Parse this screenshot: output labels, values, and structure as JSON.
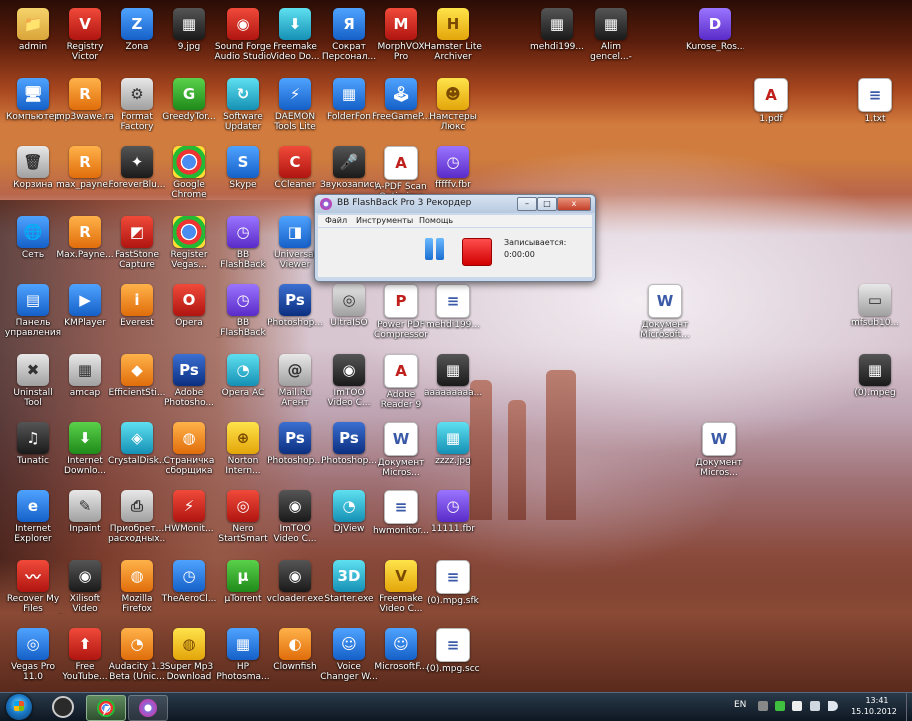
{
  "desktop": {
    "icons": [
      {
        "label": "admin",
        "icon": "user-folder-icon",
        "cls": "c-folder",
        "glyph": "📁"
      },
      {
        "label": "Registry Victor",
        "icon": "registry-victor-icon",
        "cls": "c-red",
        "glyph": "V"
      },
      {
        "label": "Zona",
        "icon": "zona-icon",
        "cls": "c-blue",
        "glyph": "Z"
      },
      {
        "label": "9.jpg",
        "icon": "image-file-icon",
        "cls": "c-dark",
        "glyph": "▦"
      },
      {
        "label": "Sound Forge Audio Studio",
        "icon": "sound-forge-icon",
        "cls": "c-red",
        "glyph": "◉"
      },
      {
        "label": "Freemake Video Do...",
        "icon": "freemake-video-downloader-icon",
        "cls": "c-cyan",
        "glyph": "⬇"
      },
      {
        "label": "Сократ Персонал...",
        "icon": "sokrat-icon",
        "cls": "c-blue",
        "glyph": "Я"
      },
      {
        "label": "MorphVOX Pro",
        "icon": "morphvox-icon",
        "cls": "c-red",
        "glyph": "M"
      },
      {
        "label": "Hamster Lite Archiver",
        "icon": "hamster-archiver-icon",
        "cls": "c-yellow",
        "glyph": "H"
      },
      {
        "label": "mehdi199...",
        "icon": "image-file-icon",
        "cls": "c-dark",
        "glyph": "▦"
      },
      {
        "label": "Alim gencel...-ta...",
        "icon": "image-file-icon",
        "cls": "c-dark",
        "glyph": "▦"
      },
      {
        "label": "Kurose_Ros...",
        "icon": "djvu-file-icon",
        "cls": "c-purple",
        "glyph": "D"
      },
      {
        "label": "Компьютер",
        "icon": "computer-icon",
        "cls": "c-blue",
        "glyph": "🖥"
      },
      {
        "label": "mp3wawe.rar",
        "icon": "rar-archive-icon",
        "cls": "c-orange",
        "glyph": "R"
      },
      {
        "label": "Format Factory",
        "icon": "format-factory-icon",
        "cls": "c-gray",
        "glyph": "⚙"
      },
      {
        "label": "GreedyTor...",
        "icon": "greedytorrent-icon",
        "cls": "c-green",
        "glyph": "G"
      },
      {
        "label": "Software Updater",
        "icon": "software-updater-icon",
        "cls": "c-cyan",
        "glyph": "↻"
      },
      {
        "label": "DAEMON Tools Lite",
        "icon": "daemon-tools-icon",
        "cls": "c-blue",
        "glyph": "⚡"
      },
      {
        "label": "FolderFon",
        "icon": "folderfon-icon",
        "cls": "c-blue",
        "glyph": "▦"
      },
      {
        "label": "FreeGameP...",
        "icon": "freegame-icon",
        "cls": "c-blue",
        "glyph": "🕹"
      },
      {
        "label": "Намстеры Люкс",
        "icon": "hamster-icon",
        "cls": "c-yellow",
        "glyph": "☻"
      },
      {
        "label": "1.pdf",
        "icon": "pdf-file-icon",
        "cls": "c-pdf",
        "glyph": "A"
      },
      {
        "label": "1.txt",
        "icon": "text-file-icon",
        "cls": "c-doc",
        "glyph": "≡"
      },
      {
        "label": "Корзина",
        "icon": "recycle-bin-icon",
        "cls": "c-gray",
        "glyph": "🗑"
      },
      {
        "label": "max_payne...",
        "icon": "rar-archive-icon",
        "cls": "c-orange",
        "glyph": "R"
      },
      {
        "label": "ForeverBlu...",
        "icon": "foreverblue-icon",
        "cls": "c-dark",
        "glyph": "✦"
      },
      {
        "label": "Google Chrome",
        "icon": "chrome-icon",
        "cls": "c-chrome",
        "glyph": ""
      },
      {
        "label": "Skype",
        "icon": "skype-icon",
        "cls": "c-blue",
        "glyph": "S"
      },
      {
        "label": "CCleaner",
        "icon": "ccleaner-icon",
        "cls": "c-red",
        "glyph": "C"
      },
      {
        "label": "Звукозапись",
        "icon": "microphone-icon",
        "cls": "c-dark",
        "glyph": "🎤"
      },
      {
        "label": "A-PDF Scan Optimizer",
        "icon": "pdf-scan-icon",
        "cls": "c-pdf",
        "glyph": "A"
      },
      {
        "label": "fffffv.fbr",
        "icon": "fbr-file-icon",
        "cls": "c-purple",
        "glyph": "◷"
      },
      {
        "label": "Сеть",
        "icon": "network-icon",
        "cls": "c-blue",
        "glyph": "🌐"
      },
      {
        "label": "Max.Payne...",
        "icon": "rar-archive-icon",
        "cls": "c-orange",
        "glyph": "R"
      },
      {
        "label": "FastStone Capture",
        "icon": "faststone-capture-icon",
        "cls": "c-red",
        "glyph": "◩"
      },
      {
        "label": "Register Vegas...",
        "icon": "chrome-icon",
        "cls": "c-chrome",
        "glyph": ""
      },
      {
        "label": "BB FlashBack Pro 3 Recor...",
        "icon": "flashback-recorder-icon",
        "cls": "c-purple",
        "glyph": "◷"
      },
      {
        "label": "Universal Viewer",
        "icon": "universal-viewer-icon",
        "cls": "c-blue",
        "glyph": "◨"
      },
      {
        "label": "Панель управления",
        "icon": "control-panel-icon",
        "cls": "c-blue",
        "glyph": "▤"
      },
      {
        "label": "KMPlayer",
        "icon": "kmplayer-icon",
        "cls": "c-blue",
        "glyph": "▶"
      },
      {
        "label": "Everest",
        "icon": "everest-icon",
        "cls": "c-orange",
        "glyph": "i"
      },
      {
        "label": "Opera",
        "icon": "opera-icon",
        "cls": "c-red",
        "glyph": "O"
      },
      {
        "label": "BB FlashBack Pro 3 Player",
        "icon": "flashback-player-icon",
        "cls": "c-purple",
        "glyph": "◷"
      },
      {
        "label": "Photoshop...",
        "icon": "photoshop-icon",
        "cls": "c-ps",
        "glyph": "Ps"
      },
      {
        "label": "UltraISO",
        "icon": "ultraiso-icon",
        "cls": "c-gray",
        "glyph": "◎"
      },
      {
        "label": "Power PDF Compressor",
        "icon": "pdf-compressor-icon",
        "cls": "c-pdf",
        "glyph": "P"
      },
      {
        "label": "mehdi199...",
        "icon": "text-file-icon",
        "cls": "c-doc",
        "glyph": "≡"
      },
      {
        "label": "Документ Microsoft...",
        "icon": "word-document-icon",
        "cls": "c-doc",
        "glyph": "W"
      },
      {
        "label": "mfsub10...",
        "icon": "monitor-file-icon",
        "cls": "c-gray",
        "glyph": "▭"
      },
      {
        "label": "Uninstall Tool",
        "icon": "uninstall-tool-icon",
        "cls": "c-gray",
        "glyph": "✖"
      },
      {
        "label": "amcap",
        "icon": "amcap-icon",
        "cls": "c-gray",
        "glyph": "▦"
      },
      {
        "label": "EfficientSti...",
        "icon": "efficient-icon",
        "cls": "c-orange",
        "glyph": "◆"
      },
      {
        "label": "Adobe Photosho...",
        "icon": "photoshop-icon",
        "cls": "c-ps",
        "glyph": "Ps"
      },
      {
        "label": "Opera AC",
        "icon": "opera-ac-icon",
        "cls": "c-cyan",
        "glyph": "◔"
      },
      {
        "label": "Mail.Ru Агент",
        "icon": "mailru-agent-icon",
        "cls": "c-gray",
        "glyph": "@"
      },
      {
        "label": "ImTOO Video C...",
        "icon": "imtoo-icon",
        "cls": "c-dark",
        "glyph": "◉"
      },
      {
        "label": "Adobe Reader 9",
        "icon": "adobe-reader-icon",
        "cls": "c-pdf",
        "glyph": "A"
      },
      {
        "label": "aaaaaaaaa...",
        "icon": "image-file-icon",
        "cls": "c-dark",
        "glyph": "▦"
      },
      {
        "label": "(0).mpeg",
        "icon": "video-file-icon",
        "cls": "c-dark",
        "glyph": "▦"
      },
      {
        "label": "Tunatic",
        "icon": "tunatic-icon",
        "cls": "c-dark",
        "glyph": "♫"
      },
      {
        "label": "Internet Downlo...",
        "icon": "internet-download-manager-icon",
        "cls": "c-green",
        "glyph": "⬇"
      },
      {
        "label": "CrystalDisk...",
        "icon": "crystaldisk-icon",
        "cls": "c-cyan",
        "glyph": "◈"
      },
      {
        "label": "Страничка сборщика",
        "icon": "basketball-icon",
        "cls": "c-orange",
        "glyph": "◍"
      },
      {
        "label": "Norton Intern...",
        "icon": "norton-icon",
        "cls": "c-yellow",
        "glyph": "⊕"
      },
      {
        "label": "Photoshop...",
        "icon": "photoshop-icon",
        "cls": "c-ps",
        "glyph": "Ps"
      },
      {
        "label": "Photoshop...",
        "icon": "photoshop-icon",
        "cls": "c-ps",
        "glyph": "Ps"
      },
      {
        "label": "Документ Micros...",
        "icon": "word-document-icon",
        "cls": "c-doc",
        "glyph": "W"
      },
      {
        "label": "zzzz.jpg",
        "icon": "image-file-icon",
        "cls": "c-cyan",
        "glyph": "▦"
      },
      {
        "label": "Документ Micros...",
        "icon": "word-document-icon",
        "cls": "c-doc",
        "glyph": "W"
      },
      {
        "label": "Internet Explorer",
        "icon": "internet-explorer-icon",
        "cls": "c-blue",
        "glyph": "e"
      },
      {
        "label": "Inpaint",
        "icon": "inpaint-icon",
        "cls": "c-gray",
        "glyph": "✎"
      },
      {
        "label": "Приобрет... расходных...",
        "icon": "printer-icon",
        "cls": "c-gray",
        "glyph": "⎙"
      },
      {
        "label": "HWMonit...",
        "icon": "hwmonitor-icon",
        "cls": "c-red",
        "glyph": "⚡"
      },
      {
        "label": "Nero StartSmart",
        "icon": "nero-icon",
        "cls": "c-red",
        "glyph": "◎"
      },
      {
        "label": "ImTOO Video C...",
        "icon": "imtoo-icon",
        "cls": "c-dark",
        "glyph": "◉"
      },
      {
        "label": "DjView",
        "icon": "djview-icon",
        "cls": "c-cyan",
        "glyph": "◔"
      },
      {
        "label": "hwmonitor...",
        "icon": "text-file-icon",
        "cls": "c-doc",
        "glyph": "≡"
      },
      {
        "label": "11111.fbr",
        "icon": "fbr-file-icon",
        "cls": "c-purple",
        "glyph": "◷"
      },
      {
        "label": "Recover My Files",
        "icon": "recover-my-files-icon",
        "cls": "c-red",
        "glyph": "〰"
      },
      {
        "label": "Xilisoft Video Converter ...",
        "icon": "xilisoft-icon",
        "cls": "c-dark",
        "glyph": "◉"
      },
      {
        "label": "Mozilla Firefox",
        "icon": "firefox-icon",
        "cls": "c-orange",
        "glyph": "◍"
      },
      {
        "label": "TheAeroCl...",
        "icon": "aeroclock-icon",
        "cls": "c-blue",
        "glyph": "◷"
      },
      {
        "label": "µTorrent",
        "icon": "utorrent-icon",
        "cls": "c-green",
        "glyph": "µ"
      },
      {
        "label": "vcloader.exe",
        "icon": "vcloader-icon",
        "cls": "c-dark",
        "glyph": "◉"
      },
      {
        "label": "Starter.exe",
        "icon": "starter-3d-icon",
        "cls": "c-cyan",
        "glyph": "3D"
      },
      {
        "label": "Freemake Video C...",
        "icon": "freemake-video-converter-icon",
        "cls": "c-yellow",
        "glyph": "V"
      },
      {
        "label": "(0).mpg.sfk",
        "icon": "text-file-icon",
        "cls": "c-doc",
        "glyph": "≡"
      },
      {
        "label": "Vegas Pro 11.0",
        "icon": "vegas-pro-icon",
        "cls": "c-blue",
        "glyph": "◎"
      },
      {
        "label": "Free YouTube...",
        "icon": "free-youtube-icon",
        "cls": "c-red",
        "glyph": "⬆"
      },
      {
        "label": "Audacity 1.3 Beta (Unic...",
        "icon": "audacity-icon",
        "cls": "c-orange",
        "glyph": "◔"
      },
      {
        "label": "Super Mp3 Download",
        "icon": "super-mp3-icon",
        "cls": "c-yellow",
        "glyph": "◍"
      },
      {
        "label": "HP Photosma...",
        "icon": "hp-photosmart-icon",
        "cls": "c-blue",
        "glyph": "▦"
      },
      {
        "label": "Clownfish",
        "icon": "clownfish-icon",
        "cls": "c-orange",
        "glyph": "◐"
      },
      {
        "label": "Voice Changer W...",
        "icon": "voice-changer-icon",
        "cls": "c-blue",
        "glyph": "☺"
      },
      {
        "label": "MicrosoftF...",
        "icon": "microsoft-fix-icon",
        "cls": "c-blue",
        "glyph": "☺"
      },
      {
        "label": "(0).mpg.scc",
        "icon": "text-file-icon",
        "cls": "c-doc",
        "glyph": "≡"
      }
    ]
  },
  "recorder_window": {
    "title": "BB FlashBack Pro 3 Рекордер",
    "minimize": "–",
    "maximize": "□",
    "close": "x",
    "menu": [
      "Файл",
      "Инструменты",
      "Помощь"
    ],
    "status_label": "Записывается:",
    "elapsed_time": "0:00:00"
  },
  "taskbar": {
    "language": "EN",
    "clock_time": "13:41",
    "clock_date": "15.10.2012",
    "tasks": [
      {
        "icon": "media-player-icon"
      },
      {
        "icon": "chrome-taskbar-icon"
      },
      {
        "icon": "flashback-recorder-icon"
      }
    ],
    "tray_icons": [
      "signal-bars-icon",
      "battery-icon",
      "flag-icon",
      "network-tray-icon",
      "volume-icon"
    ]
  }
}
